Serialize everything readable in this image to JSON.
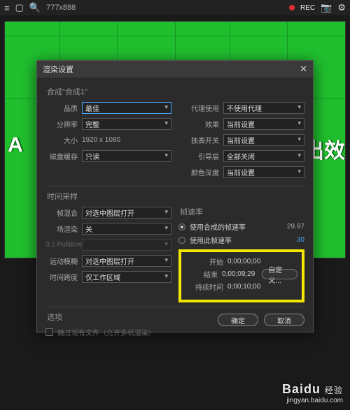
{
  "topbar": {
    "dimensions": "777x888",
    "rec": "REC"
  },
  "viewport": {
    "text_left": "A",
    "text_right": "凸出效"
  },
  "dialog": {
    "title": "渲染设置",
    "comp_label": "合成\"合成1\"",
    "left_rows": [
      {
        "label": "品质",
        "value": "最佳",
        "hl": true
      },
      {
        "label": "分辨率",
        "value": "完整",
        "hl": false
      },
      {
        "label": "大小",
        "value": "1920 x 1080",
        "plain": true
      },
      {
        "label": "磁盘缓存",
        "value": "只读",
        "hl": false
      }
    ],
    "right_rows": [
      {
        "label": "代理使用",
        "value": "不使用代理"
      },
      {
        "label": "效果",
        "value": "当前设置"
      },
      {
        "label": "独奏开关",
        "value": "当前设置"
      },
      {
        "label": "引导层",
        "value": "全部关闭"
      },
      {
        "label": "颜色深度",
        "value": "当前设置"
      }
    ],
    "section2_title": "时间采样",
    "section2_left": [
      {
        "label": "帧混合",
        "value": "对选中图层打开"
      },
      {
        "label": "场渲染",
        "value": "关"
      },
      {
        "label": "3:2 Pulldown",
        "value": "",
        "disabled": true
      },
      {
        "label": "运动模糊",
        "value": "对选中图层打开"
      },
      {
        "label": "时间跨度",
        "value": "仅工作区域"
      }
    ],
    "framerate": {
      "title": "帧速率",
      "opt1": "使用合成的帧速率",
      "opt1_val": "29.97",
      "opt2": "使用此帧速率",
      "opt2_val": "30"
    },
    "timing": {
      "start_label": "开始",
      "start_val": "0;00;00;00",
      "end_label": "结束",
      "end_val": "0;00;09;29",
      "custom_btn": "自定义...",
      "dur_label": "持续时间",
      "dur_val": "0;00;10;00"
    },
    "options_title": "选项",
    "skip_label": "跳过现有文件（允许多机渲染）",
    "ok": "确定",
    "cancel": "取消"
  },
  "watermark": {
    "brand": "Baidu",
    "sub": "经验",
    "url": "jingyan.baidu.com"
  }
}
